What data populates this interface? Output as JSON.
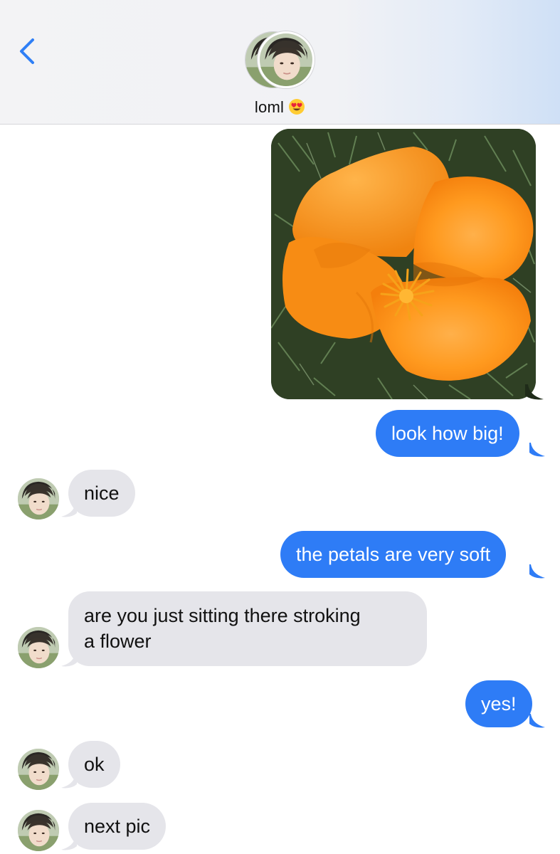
{
  "header": {
    "contact_name": "loml",
    "contact_emoji": "heart-eyes-emoji"
  },
  "messages": [
    {
      "side": "outgoing",
      "type": "photo",
      "photo": "orange-poppy-flower"
    },
    {
      "side": "outgoing",
      "text": "look how big!"
    },
    {
      "side": "incoming",
      "text": "nice"
    },
    {
      "side": "outgoing",
      "text": "the petals are very soft"
    },
    {
      "side": "incoming",
      "lines": [
        "are you just sitting there stroking",
        "a flower"
      ]
    },
    {
      "side": "outgoing",
      "text": "yes!"
    },
    {
      "side": "incoming",
      "text": "ok"
    },
    {
      "side": "incoming",
      "text": "next pic"
    }
  ],
  "colors": {
    "outgoing_bubble": "#2e7cf6",
    "incoming_bubble": "#e5e5ea",
    "accent": "#2f7ff6"
  }
}
